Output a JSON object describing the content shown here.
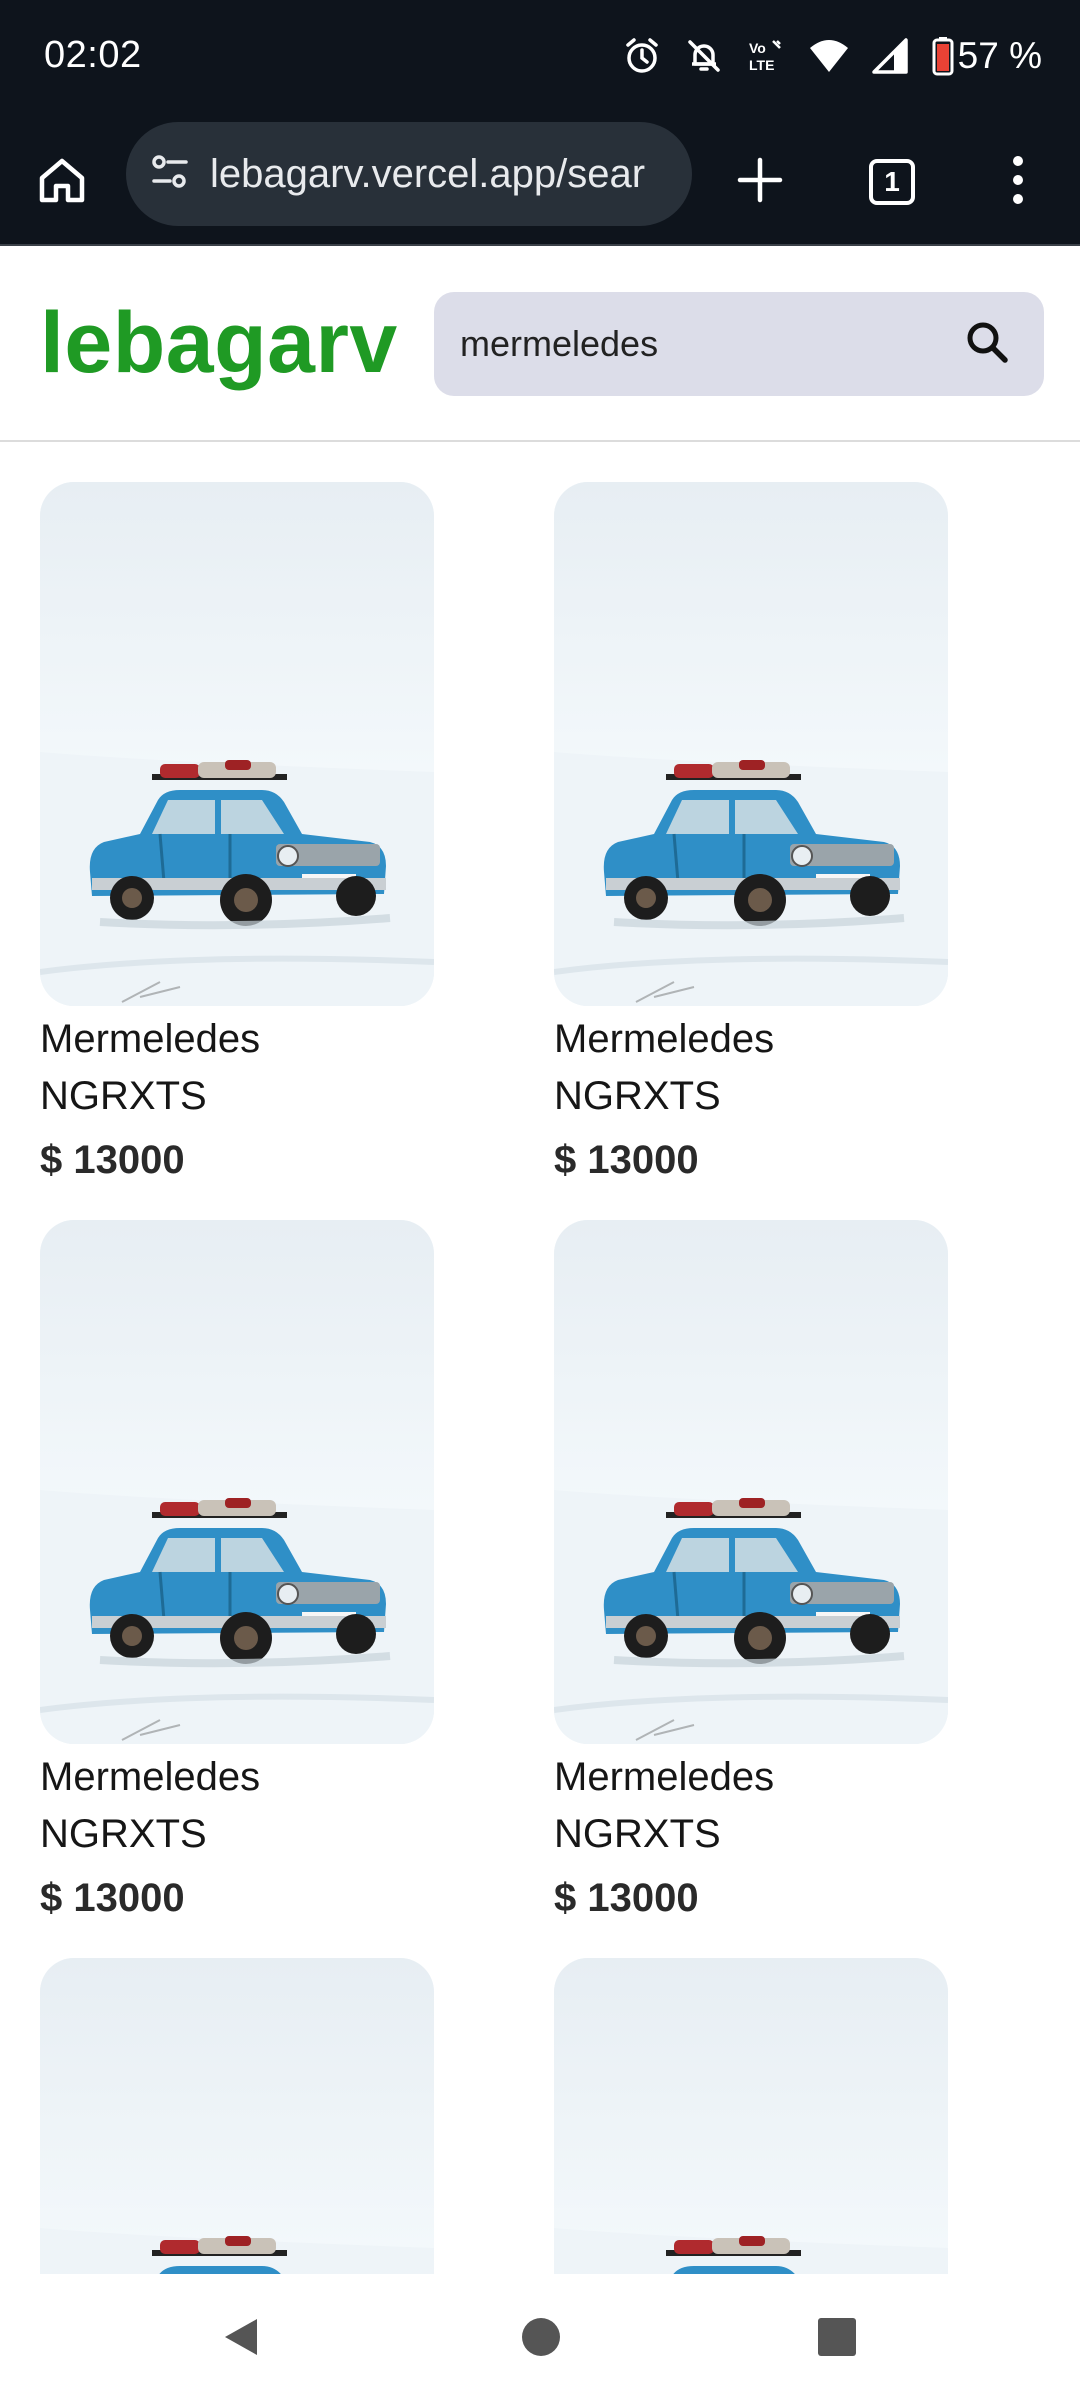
{
  "status_bar": {
    "time": "02:02",
    "battery_percent": "57 %",
    "icons": [
      "alarm-icon",
      "bell-off-icon",
      "volte-icon",
      "wifi-icon",
      "signal-icon",
      "battery-icon"
    ]
  },
  "browser": {
    "url": "lebagarv.vercel.app/sear",
    "tab_count": "1",
    "icons": [
      "home-icon",
      "site-settings-icon",
      "new-tab-icon",
      "tabs-icon",
      "more-menu-icon"
    ]
  },
  "site": {
    "logo": "lebagarv",
    "logo_color": "#1f9a24",
    "search_value": "mermeledes",
    "search_icon": "search-icon"
  },
  "products": [
    {
      "title": "Mermeledes",
      "brand": "NGRXTS",
      "price": "$ 13000"
    },
    {
      "title": "Mermeledes",
      "brand": "NGRXTS",
      "price": "$ 13000"
    },
    {
      "title": "Mermeledes",
      "brand": "NGRXTS",
      "price": "$ 13000"
    },
    {
      "title": "Mermeledes",
      "brand": "NGRXTS",
      "price": "$ 13000"
    },
    {
      "title": "",
      "brand": "",
      "price": ""
    },
    {
      "title": "",
      "brand": "",
      "price": ""
    }
  ],
  "nav_bar": {
    "icons": [
      "back-icon",
      "home-circle-icon",
      "recents-icon"
    ]
  }
}
